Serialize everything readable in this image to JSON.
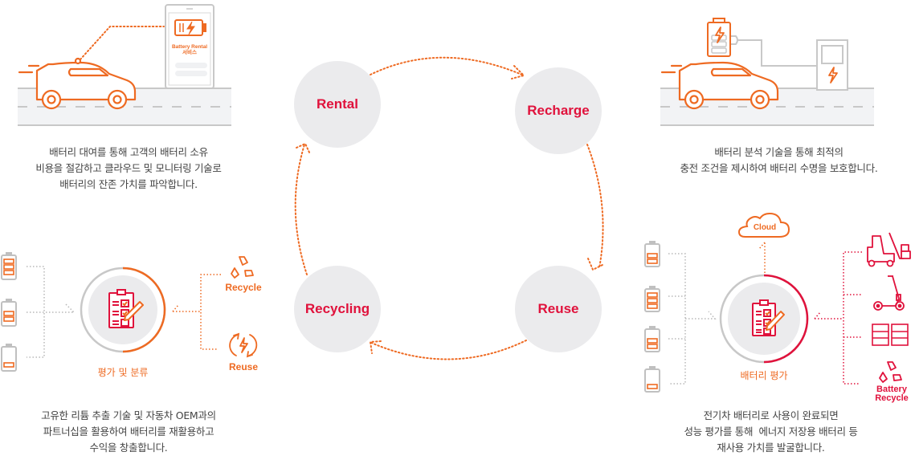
{
  "colors": {
    "orange": "#ee6a22",
    "red": "#e0123c",
    "gray_line": "#c8c8c8",
    "node_bg": "#ebebed",
    "road": "#f2f3f5",
    "text": "#444444"
  },
  "cycle": {
    "nodes": [
      {
        "id": "rental",
        "label": "Rental"
      },
      {
        "id": "recharge",
        "label": "Recharge"
      },
      {
        "id": "reuse",
        "label": "Reuse"
      },
      {
        "id": "recycling",
        "label": "Recycling"
      }
    ],
    "flow": [
      "Rental",
      "Recharge",
      "Reuse",
      "Recycling",
      "Rental"
    ]
  },
  "rental": {
    "phone_label_line1": "Battery Rental",
    "phone_label_line2": "서비스",
    "description": [
      "배터리 대여를 통해 고객의 배터리 소유",
      "비용을 절감하고 클라우드 및 모니터링 기술로",
      "배터리의 잔존 가치를 파악합니다."
    ]
  },
  "recharge": {
    "description": [
      "배터리 분석 기술을 통해 최적의",
      "충전 조건을 제시하여 배터리 수명을 보호합니다."
    ]
  },
  "recycling": {
    "center_label": "평가 및 분류",
    "outputs": [
      "Recycle",
      "Reuse"
    ],
    "battery_levels": [
      3,
      2,
      1
    ],
    "description": [
      "고유한 리튬 추출 기술 및 자동차 OEM과의",
      "파트너십을 활용하여 배터리를 재활용하고",
      "수익을 창출합니다."
    ]
  },
  "reuse": {
    "center_label": "배터리 평가",
    "cloud_label": "Cloud",
    "outputs": [
      "forklift",
      "e-scooter",
      "energy-storage",
      "Battery Recycle"
    ],
    "recycle_label_line1": "Battery",
    "recycle_label_line2": "Recycle",
    "battery_levels": [
      2,
      3,
      2,
      1
    ],
    "description": [
      "전기차 배터리로 사용이 완료되면",
      "성능 평가를 통해  에너지 저장용 배터리 등",
      "재사용 가치를 발굴합니다."
    ]
  }
}
